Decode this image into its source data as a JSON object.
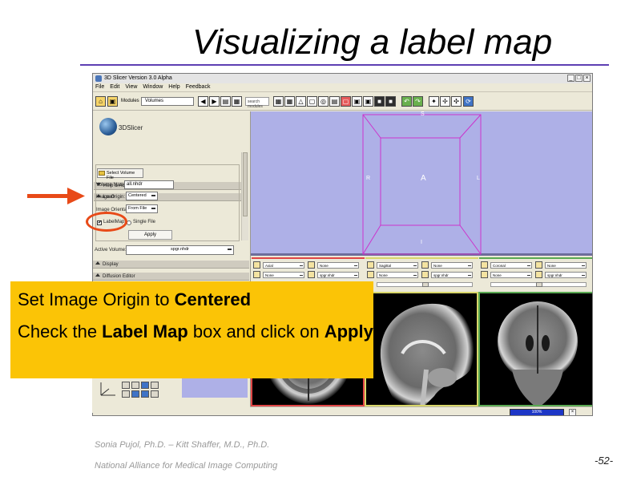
{
  "slide": {
    "title": "Visualizing a label map",
    "footer_line1": "Sonia Pujol, Ph.D. – Kitt Shaffer, M.D., Ph.D.",
    "footer_line2": "National Alliance for Medical Image Computing",
    "page_number": "-52-"
  },
  "window": {
    "title": "3D Slicer Version 3.0 Alpha",
    "buttons": [
      "_",
      "□",
      "×"
    ],
    "menu": [
      "File",
      "Edit",
      "View",
      "Window",
      "Help",
      "Feedback"
    ]
  },
  "toolbar": {
    "modules_label": "Modules",
    "modules_value": "Volumes",
    "search_placeholder": "search modules"
  },
  "left_panel": {
    "logo_text": "3DSlicer",
    "help_section": "Help & Acknowledgement",
    "load_section": "Load",
    "select_file_button": "Select Volume File",
    "volume_name_label": "Volume Name:",
    "volume_name_value": "all.nhdr",
    "image_origin_label": "Image Origin:",
    "image_origin_value": "Centered",
    "image_orientation_label": "Image Orientati",
    "image_orientation_value": "From File",
    "label_map_checkbox": "LabelMap",
    "label_map_checked": "✔",
    "single_file_label": "Single File",
    "apply_button": "Apply",
    "active_volume_label": "Active Volume:",
    "active_volume_value": "spgr.nhdr",
    "display_section": "Display",
    "diffusion_section": "Diffusion Editor"
  },
  "view3d": {
    "orient_s": "S",
    "orient_r": "R",
    "orient_a": "A",
    "orient_l": "L",
    "orient_i": "I"
  },
  "slice_controls": [
    {
      "view": "axial",
      "orientation": "Axial",
      "fg": "None",
      "bg": "None",
      "label": "spgr.nhdr",
      "color": "#e04646"
    },
    {
      "view": "sagittal",
      "orientation": "Sagittal",
      "fg": "None",
      "bg": "None",
      "label": "spgr.nhdr",
      "color": "#d8d66a"
    },
    {
      "view": "coronal",
      "orientation": "Coronal",
      "fg": "None",
      "bg": "None",
      "label": "spgr.nhdr",
      "color": "#5aa952"
    }
  ],
  "statusbar": {
    "progress_text": "100%",
    "progress_fraction": 1.0
  },
  "overlay": {
    "line1_pre": "Set Image Origin to ",
    "line1_bold": "Centered",
    "line2_pre": "Check the ",
    "line2_bold": "Label Map",
    "line2_mid": " box and click on ",
    "line2_bold2": "Apply"
  }
}
